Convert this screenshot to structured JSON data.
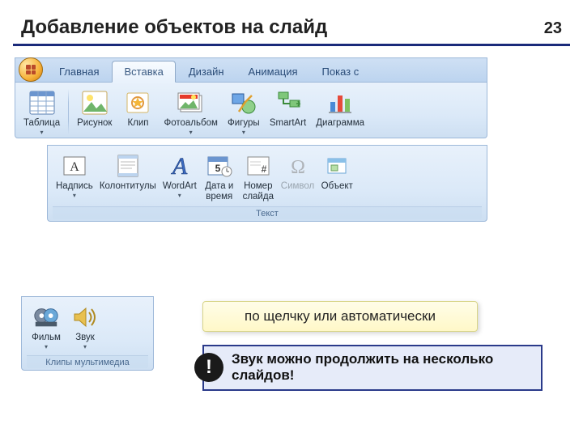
{
  "page": {
    "title": "Добавление объектов на слайд",
    "number": "23"
  },
  "tabs": {
    "home": "Главная",
    "insert": "Вставка",
    "design": "Дизайн",
    "animation": "Анимация",
    "show": "Показ с"
  },
  "ribbon1": {
    "table": "Таблица",
    "picture": "Рисунок",
    "clip": "Клип",
    "album": "Фотоальбом",
    "shapes": "Фигуры",
    "smartart": "SmartArt",
    "chart": "Диаграмма"
  },
  "ribbon2": {
    "textbox": "Надпись",
    "headerfooter": "Колонтитулы",
    "wordart": "WordArt",
    "datetime": "Дата и\nвремя",
    "slidenum": "Номер\nслайда",
    "symbol": "Символ",
    "object": "Объект",
    "group": "Текст"
  },
  "ribbon3": {
    "movie": "Фильм",
    "sound": "Звук",
    "group": "Клипы мультимедиа"
  },
  "callouts": {
    "yellow": "по щелчку или автоматически",
    "info": "Звук можно продолжить на несколько слайдов!"
  }
}
